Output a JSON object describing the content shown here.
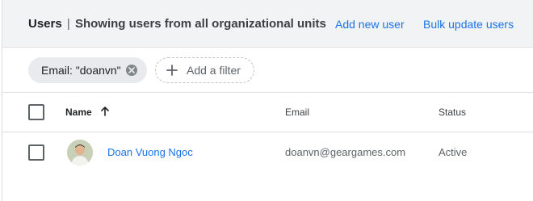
{
  "header": {
    "title": "Users",
    "separator": "|",
    "subtitle": "Showing users from all organizational units",
    "add_user_label": "Add new user",
    "bulk_update_label": "Bulk update users"
  },
  "filters": {
    "chip_label": "Email: \"doanvn\"",
    "close_icon": "cancel-icon",
    "add_filter_label": "Add a filter",
    "add_icon": "plus-icon"
  },
  "table": {
    "columns": {
      "name": "Name",
      "email": "Email",
      "status": "Status"
    },
    "sort_icon": "arrow-up-icon",
    "rows": [
      {
        "name": "Doan Vuong Ngoc",
        "email": "doanvn@geargames.com",
        "status": "Active"
      }
    ]
  },
  "colors": {
    "link": "#1a73e8",
    "header_bg": "#f1f3f4",
    "chip_bg": "#e8eaed"
  }
}
